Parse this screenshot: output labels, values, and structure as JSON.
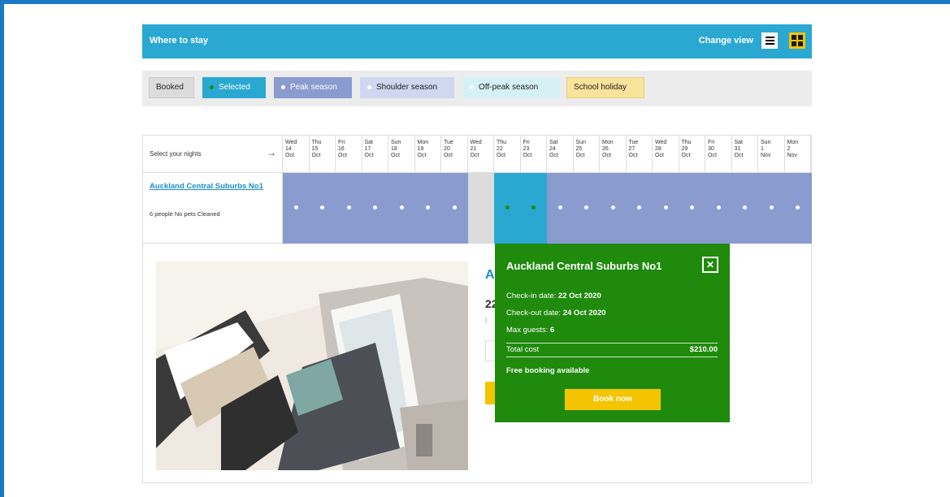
{
  "header": {
    "title": "Where to stay",
    "change_view_label": "Change view",
    "colors": {
      "bar": "#2aa8d2",
      "active_toggle": "#f4c400"
    }
  },
  "legend": [
    {
      "label": "Booked",
      "bg": "#dcdcdc",
      "color": "#222",
      "dot": null
    },
    {
      "label": "Selected",
      "bg": "#2aa8d2",
      "color": "#ffffff",
      "dot": "#1f8a0c"
    },
    {
      "label": "Peak season",
      "bg": "#8a9bd0",
      "color": "#ffffff",
      "dot": "#ffffff"
    },
    {
      "label": "Shoulder season",
      "bg": "#cfd8f0",
      "color": "#222",
      "dot": "#ffffff"
    },
    {
      "label": "Off-peak season",
      "bg": "#d6f1f6",
      "color": "#222",
      "dot": "#ffffff"
    },
    {
      "label": "School holiday",
      "bg": "#fae39a",
      "color": "#222",
      "dot": null
    }
  ],
  "calendar": {
    "select_label": "Select your nights",
    "dates": [
      {
        "day": "Wed",
        "date": "14",
        "month": "Oct",
        "status": "peak"
      },
      {
        "day": "Thu",
        "date": "15",
        "month": "Oct",
        "status": "peak"
      },
      {
        "day": "Fri",
        "date": "16",
        "month": "Oct",
        "status": "peak"
      },
      {
        "day": "Sat",
        "date": "17",
        "month": "Oct",
        "status": "peak"
      },
      {
        "day": "Sun",
        "date": "18",
        "month": "Oct",
        "status": "peak"
      },
      {
        "day": "Mon",
        "date": "19",
        "month": "Oct",
        "status": "peak"
      },
      {
        "day": "Tue",
        "date": "20",
        "month": "Oct",
        "status": "peak"
      },
      {
        "day": "Wed",
        "date": "21",
        "month": "Oct",
        "status": "booked"
      },
      {
        "day": "Thu",
        "date": "22",
        "month": "Oct",
        "status": "selected"
      },
      {
        "day": "Fri",
        "date": "23",
        "month": "Oct",
        "status": "selected"
      },
      {
        "day": "Sat",
        "date": "24",
        "month": "Oct",
        "status": "peak"
      },
      {
        "day": "Sun",
        "date": "25",
        "month": "Oct",
        "status": "peak"
      },
      {
        "day": "Mon",
        "date": "26",
        "month": "Oct",
        "status": "peak"
      },
      {
        "day": "Tue",
        "date": "27",
        "month": "Oct",
        "status": "peak"
      },
      {
        "day": "Wed",
        "date": "28",
        "month": "Oct",
        "status": "peak"
      },
      {
        "day": "Thu",
        "date": "29",
        "month": "Oct",
        "status": "peak"
      },
      {
        "day": "Fri",
        "date": "30",
        "month": "Oct",
        "status": "peak"
      },
      {
        "day": "Sat",
        "date": "31",
        "month": "Oct",
        "status": "peak"
      },
      {
        "day": "Sun",
        "date": "1",
        "month": "Nov",
        "status": "peak"
      },
      {
        "day": "Mon",
        "date": "2",
        "month": "Nov",
        "status": "peak"
      }
    ],
    "status_colors": {
      "peak": {
        "bg": "#8a9bd0",
        "dot": "#ffffff"
      },
      "booked": {
        "bg": "#dcdcdc",
        "dot": null
      },
      "selected": {
        "bg": "#2aa8d2",
        "dot": "#1f8a0c"
      }
    }
  },
  "property": {
    "name": "Auckland Central Suburbs No1",
    "meta": "6 people  No pets  Cleaned"
  },
  "detail": {
    "name_partial": "A",
    "date_partial": "22"
  },
  "popup": {
    "title": "Auckland Central Suburbs No1",
    "close_icon": "close-icon",
    "checkin_label": "Check-in date:",
    "checkin_value": "22 Oct 2020",
    "checkout_label": "Check-out date:",
    "checkout_value": "24 Oct 2020",
    "guests_label": "Max guests:",
    "guests_value": "6",
    "total_label": "Total cost",
    "total_value": "$210.00",
    "free_booking": "Free booking available",
    "book_label": "Book now"
  }
}
